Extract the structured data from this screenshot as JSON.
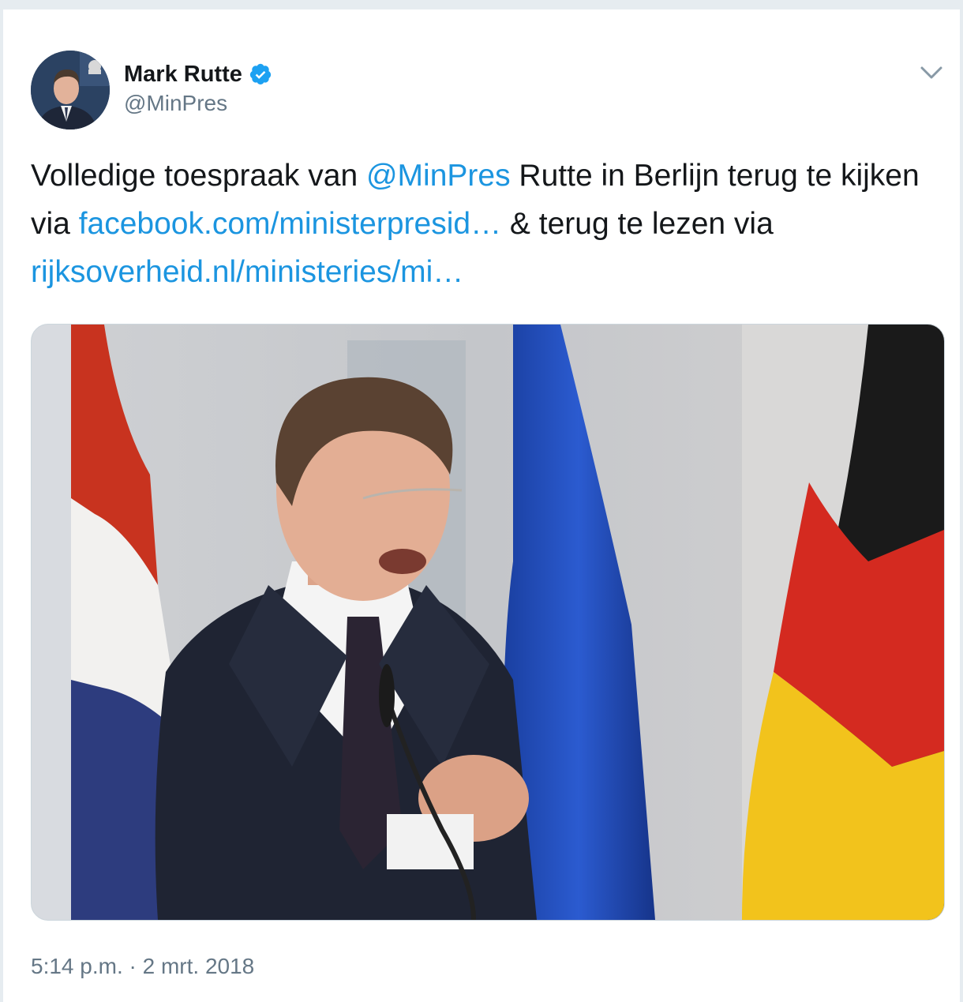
{
  "tweet": {
    "author": {
      "display_name": "Mark Rutte",
      "handle": "@MinPres",
      "verified": true,
      "avatar_icon": "profile-photo"
    },
    "menu_icon": "chevron-down-icon",
    "text": {
      "part1": "Volledige toespraak van ",
      "mention": "@MinPres",
      "part2": " Rutte in Berlijn terug te kijken via ",
      "link1": "facebook.com/ministerpresid…",
      "part3": " & terug te lezen via ",
      "link2": "rijksoverheid.nl/ministeries/mi…"
    },
    "media": {
      "description_icon": "photo-of-speaker-at-lectern-with-flags"
    },
    "timestamp": "5:14 p.m. · 2 mrt. 2018"
  },
  "colors": {
    "link": "#1b95e0",
    "text": "#14171a",
    "secondary": "#657786",
    "verified": "#1da1f2"
  }
}
